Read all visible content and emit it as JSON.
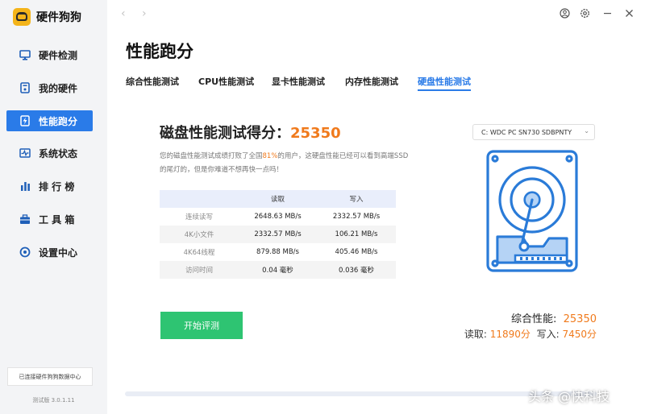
{
  "app": {
    "name": "硬件狗狗"
  },
  "sidebar": {
    "items": [
      {
        "label": "硬件检测",
        "icon": "monitor-icon"
      },
      {
        "label": "我的硬件",
        "icon": "hardware-icon"
      },
      {
        "label": "性能跑分",
        "icon": "lightning-icon",
        "active": true
      },
      {
        "label": "系统状态",
        "icon": "pulse-icon"
      },
      {
        "label": "排 行 榜",
        "icon": "bar-chart-icon"
      },
      {
        "label": "工 具 箱",
        "icon": "toolbox-icon"
      },
      {
        "label": "设置中心",
        "icon": "settings-icon"
      }
    ],
    "sync_text": "已连接硬件狗狗数据中心",
    "version": "测试版 3.0.1.11"
  },
  "page": {
    "title": "性能跑分",
    "tabs": [
      {
        "label": "综合性能测试"
      },
      {
        "label": "CPU性能测试"
      },
      {
        "label": "显卡性能测试"
      },
      {
        "label": "内存性能测试"
      },
      {
        "label": "硬盘性能测试",
        "active": true
      }
    ]
  },
  "result": {
    "title_prefix": "磁盘性能测试得分：",
    "score": "25350",
    "desc_before": "您的磁盘性能测试成绩打败了全国",
    "desc_percent": "81%",
    "desc_after": "的用户，这硬盘性能已经可以看到高端SSD的尾灯的，但是你难道不想再快一点吗！",
    "table": {
      "headers": [
        "",
        "读取",
        "写入"
      ],
      "rows": [
        [
          "连续读写",
          "2648.63 MB/s",
          "2332.57 MB/s"
        ],
        [
          "4K小文件",
          "2332.57 MB/s",
          "106.21 MB/s"
        ],
        [
          "4K64线程",
          "879.88 MB/s",
          "405.46 MB/s"
        ],
        [
          "访问时间",
          "0.04 毫秒",
          "0.036 毫秒"
        ]
      ]
    },
    "start_button": "开始评测"
  },
  "disk": {
    "selected": "C: WDC PC SN730 SDBPNTY",
    "total_label": "综合性能:",
    "total_value": "25350",
    "read_label": "读取:",
    "read_value": "11890分",
    "write_label": "写入:",
    "write_value": "7450分"
  },
  "colors": {
    "accent": "#2a7be8",
    "score": "#f07a1c",
    "start_button": "#2ec472",
    "disk_icon": "#2a7bd8"
  },
  "watermark": "头条 @快科技"
}
